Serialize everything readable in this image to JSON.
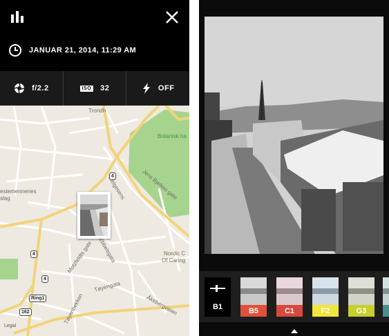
{
  "metadata_panel": {
    "date": "JANUAR 21, 2014, 11:29 AM",
    "aperture": "f/2.2",
    "iso_badge": "ISO",
    "iso": "32",
    "flash": "OFF"
  },
  "map": {
    "labels": {
      "trondh": "Trondh",
      "botanisk": "Botanisk ha",
      "estemennenes": "estemennenes",
      "slag": "slag",
      "jens_bjelkes": "Jens Bjelkes gate",
      "helgesens": "Helgesens",
      "motzfeldts": "Motzfeldts gate",
      "ebbelsgata": "Ebbelsgata",
      "nordic": "Nordic C",
      "of_caring": "Of Caring",
      "toyengata": "Tøyengata",
      "toyenbekken": "Tøyenbekken",
      "akebergveien": "Åkebergveien",
      "legal": "Legal"
    },
    "road_badges": [
      "4",
      "4",
      "4",
      "Ring1",
      "162"
    ]
  },
  "filters": {
    "selected_label": "B1",
    "items": [
      {
        "label": "B5",
        "color": "#e0503a"
      },
      {
        "label": "C1",
        "color": "#d9483c"
      },
      {
        "label": "F2",
        "color": "#f3e63a"
      },
      {
        "label": "G3",
        "color": "#c7cf2e"
      },
      {
        "label": "",
        "color": "#4a8f8a"
      }
    ]
  },
  "colors": {
    "park": "#9ed08a",
    "road_major": "#f3d37a",
    "accent_c1": "#d9483c"
  }
}
